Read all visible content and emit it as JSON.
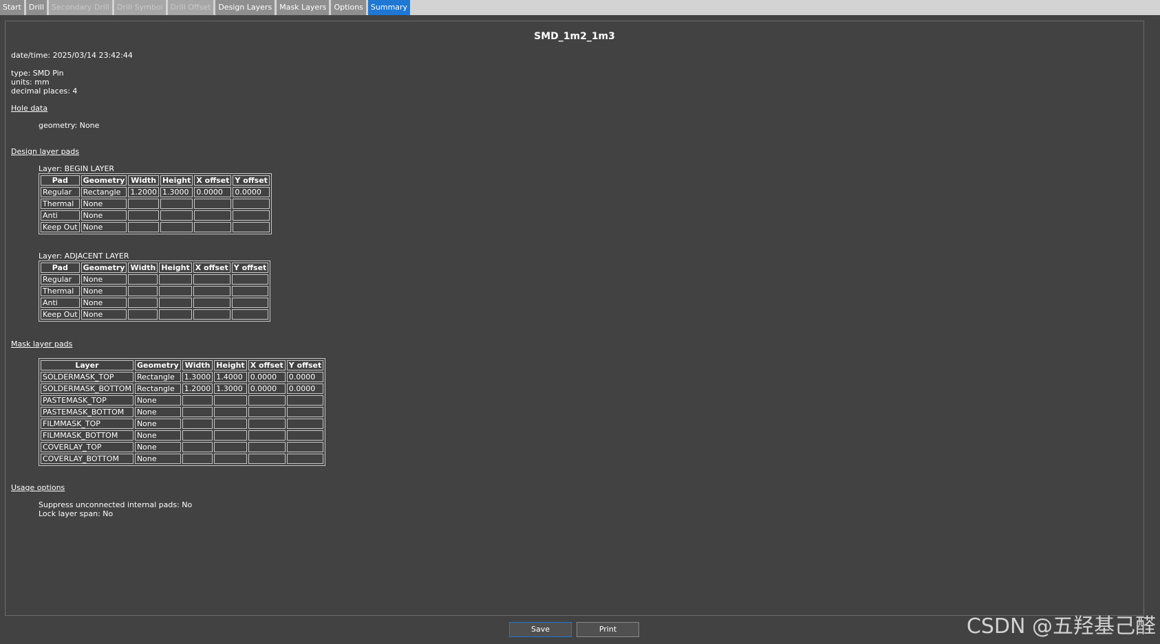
{
  "tabs": [
    {
      "label": "Start",
      "state": "normal"
    },
    {
      "label": "Drill",
      "state": "normal"
    },
    {
      "label": "Secondary Drill",
      "state": "disabled"
    },
    {
      "label": "Drill Symbol",
      "state": "disabled"
    },
    {
      "label": "Drill Offset",
      "state": "disabled"
    },
    {
      "label": "Design Layers",
      "state": "normal"
    },
    {
      "label": "Mask Layers",
      "state": "normal"
    },
    {
      "label": "Options",
      "state": "normal"
    },
    {
      "label": "Summary",
      "state": "active"
    }
  ],
  "summary": {
    "title": "SMD_1m2_1m3",
    "datetime": "date/time: 2025/03/14 23:42:44",
    "type": "type: SMD Pin",
    "units": "units: mm",
    "decimal_places": "decimal places: 4",
    "hole_data_heading": "Hole data",
    "hole_geometry": "geometry: None",
    "design_heading": "Design layer pads",
    "begin_layer_label": "Layer: BEGIN LAYER",
    "adjacent_layer_label": "Layer: ADJACENT LAYER",
    "pad_headers": [
      "Pad",
      "Geometry",
      "Width",
      "Height",
      "X offset",
      "Y offset"
    ],
    "begin_rows": [
      [
        "Regular",
        "Rectangle",
        "1.2000",
        "1.3000",
        "0.0000",
        "0.0000"
      ],
      [
        "Thermal",
        "None",
        "",
        "",
        "",
        ""
      ],
      [
        "Anti",
        "None",
        "",
        "",
        "",
        ""
      ],
      [
        "Keep Out",
        "None",
        "",
        "",
        "",
        ""
      ]
    ],
    "adjacent_rows": [
      [
        "Regular",
        "None",
        "",
        "",
        "",
        ""
      ],
      [
        "Thermal",
        "None",
        "",
        "",
        "",
        ""
      ],
      [
        "Anti",
        "None",
        "",
        "",
        "",
        ""
      ],
      [
        "Keep Out",
        "None",
        "",
        "",
        "",
        ""
      ]
    ],
    "mask_heading": "Mask layer pads",
    "mask_headers": [
      "Layer",
      "Geometry",
      "Width",
      "Height",
      "X offset",
      "Y offset"
    ],
    "mask_rows": [
      [
        "SOLDERMASK_TOP",
        "Rectangle",
        "1.3000",
        "1.4000",
        "0.0000",
        "0.0000"
      ],
      [
        "SOLDERMASK_BOTTOM",
        "Rectangle",
        "1.2000",
        "1.3000",
        "0.0000",
        "0.0000"
      ],
      [
        "PASTEMASK_TOP",
        "None",
        "",
        "",
        "",
        ""
      ],
      [
        "PASTEMASK_BOTTOM",
        "None",
        "",
        "",
        "",
        ""
      ],
      [
        "FILMMASK_TOP",
        "None",
        "",
        "",
        "",
        ""
      ],
      [
        "FILMMASK_BOTTOM",
        "None",
        "",
        "",
        "",
        ""
      ],
      [
        "COVERLAY_TOP",
        "None",
        "",
        "",
        "",
        ""
      ],
      [
        "COVERLAY_BOTTOM",
        "None",
        "",
        "",
        "",
        ""
      ]
    ],
    "usage_heading": "Usage options",
    "suppress": "Suppress unconnected internal pads: No",
    "lock_span": "Lock layer span: No"
  },
  "buttons": {
    "save": "Save",
    "print": "Print"
  },
  "watermark": "CSDN @五羟基己醛",
  "colors": {
    "background": "#424242",
    "active_tab": "#1e78d4",
    "tabbar": "#d3d3d3"
  }
}
